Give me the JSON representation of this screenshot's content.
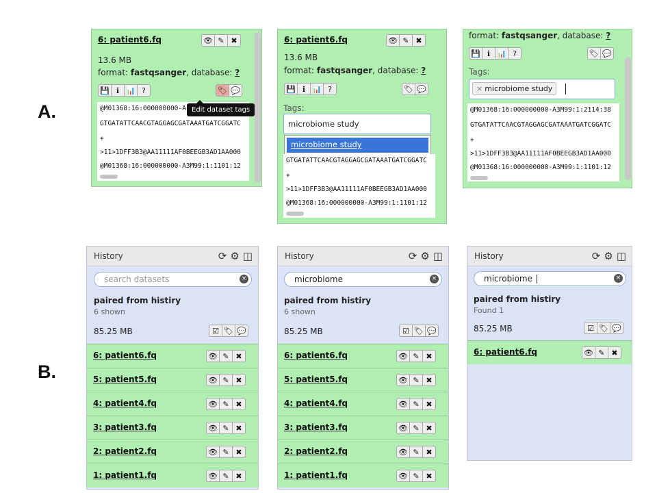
{
  "labels": {
    "a": "A.",
    "b": "B."
  },
  "panelA1": {
    "title": "6: patient6.fq",
    "size": "13.6 MB",
    "format_label": "format:",
    "format_value": "fastqsanger",
    "database_label": ", database:",
    "database_value": "?",
    "tooltip": "Edit dataset tags",
    "peek": [
      "@M01368:16:000000000-A",
      "GTGATATTCAACGTAGGAGCGATAAATGATCGGATC",
      "+",
      ">11>1DFF3B3@AA11111AF0BEEGB3AD1AA000",
      "@M01368:16:000000000-A3M99:1:1101:12"
    ]
  },
  "panelA2": {
    "title": "6: patient6.fq",
    "size": "13.6 MB",
    "format_label": "format:",
    "format_value": "fastqsanger",
    "database_label": ", database:",
    "database_value": "?",
    "tags_label": "Tags:",
    "tags_input_value": "microbiome study",
    "dropdown_option": "microbiome study",
    "peek": [
      "GTGATATTCAACGTAGGAGCGATAAATGATCGGATC",
      "+",
      ">11>1DFF3B3@AA11111AF0BEEGB3AD1AA000",
      "@M01368:16:000000000-A3M99:1:1101:12"
    ]
  },
  "panelA3": {
    "format_label": "format:",
    "format_value": "fastqsanger",
    "database_label": ", database:",
    "database_value": "?",
    "tags_label": "Tags:",
    "tag": "microbiome study",
    "tag_remove": "×",
    "peek": [
      "@M01368:16:000000000-A3M99:1:2114:38",
      "GTGATATTCAACGTAGGAGCGATAAATGATCGGATC",
      "+",
      ">11>1DFF3B3@AA11111AF0BEEGB3AD1AA000",
      "@M01368:16:000000000-A3M99:1:1101:12"
    ]
  },
  "historyB1": {
    "title": "History",
    "search_placeholder": "search datasets",
    "name": "paired from histiry",
    "shown": "6 shown",
    "size": "85.25 MB",
    "datasets": [
      "6: patient6.fq",
      "5: patient5.fq",
      "4: patient4.fq",
      "3: patient3.fq",
      "2: patient2.fq",
      "1: patient1.fq"
    ]
  },
  "historyB2": {
    "title": "History",
    "search_value": "microbiome",
    "name": "paired from histiry",
    "shown": "6 shown",
    "size": "85.25 MB",
    "datasets": [
      "6: patient6.fq",
      "5: patient5.fq",
      "4: patient4.fq",
      "3: patient3.fq",
      "2: patient2.fq",
      "1: patient1.fq"
    ]
  },
  "historyB3": {
    "title": "History",
    "search_value": "microbiome",
    "name": "paired from histiry",
    "found": "Found 1",
    "size": "85.25 MB",
    "datasets": [
      "6: patient6.fq"
    ]
  },
  "icons": {
    "eye": "👁",
    "pencil": "✎",
    "close": "✖",
    "save": "💾",
    "info": "ℹ",
    "chart": "📊",
    "help": "?",
    "tag": "🏷",
    "comment": "💬",
    "refresh": "⟳",
    "gear": "⚙",
    "columns": "◫",
    "check": "☑",
    "clear": "×"
  },
  "colors": {
    "dataset_green": "#b0eeb1",
    "history_blue": "#dde3f7",
    "tag_highlight": "#c0392b",
    "selection_blue": "#3875d7"
  }
}
